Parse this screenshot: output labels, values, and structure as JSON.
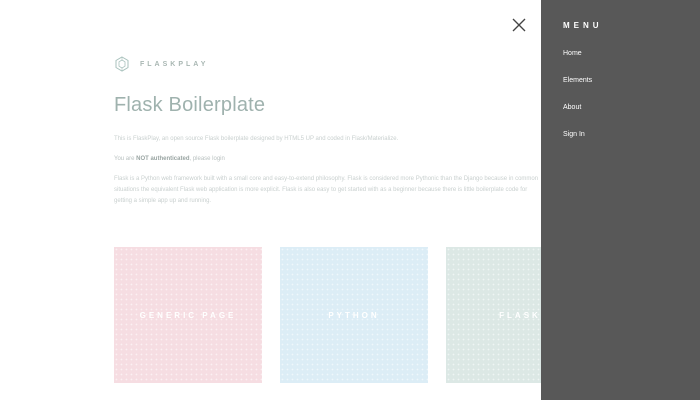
{
  "brand": {
    "name": "FLASKPLAY",
    "icon": "hexagon-logo-icon"
  },
  "main": {
    "title": "Flask Boilerplate",
    "para1": "This is FlaskPlay, an open source Flask boilerplate designed by HTML5 UP and coded in Flask/Materialize.",
    "para2_before": "You are",
    "para2_bold": "NOT authenticated",
    "para2_after": ", please login",
    "para3": "Flask is a Python web framework built with a small core and easy-to-extend philosophy. Flask is considered more Pythonic than the Django because in common situations the equivalent Flask web application is more explicit. Flask is also easy to get started with as a beginner because there is little boilerplate code for getting a simple app up and running."
  },
  "tiles": [
    {
      "label": "GENERIC PAGE",
      "color": "#f6dde2"
    },
    {
      "label": "PYTHON",
      "color": "#dcedf6"
    },
    {
      "label": "FLASK",
      "color": "#dce8e5"
    }
  ],
  "close": {
    "icon": "close-icon"
  },
  "menu": {
    "title": "MENU",
    "background": "#585858",
    "items": [
      {
        "label": "Home"
      },
      {
        "label": "Elements"
      },
      {
        "label": "About"
      },
      {
        "label": "Sign In"
      }
    ]
  }
}
